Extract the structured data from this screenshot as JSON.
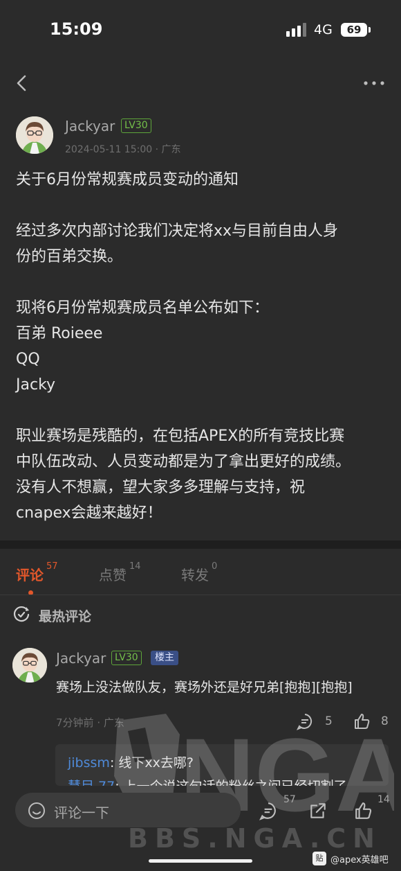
{
  "status_bar": {
    "time": "15:09",
    "network": "4G",
    "battery": "69"
  },
  "post": {
    "author": "Jackyar",
    "level": "LV30",
    "date": "2024-05-11  15:00",
    "location": "广东",
    "lines": [
      "关于6月份常规赛成员变动的通知",
      "",
      "经过多次内部讨论我们决定将xx与目前自由人身",
      "份的百弟交换。",
      "",
      "现将6月份常规赛成员名单公布如下：",
      "百弟 Roieee",
      "QQ",
      "Jacky",
      "",
      "职业赛场是残酷的，在包括APEX的所有竞技比赛",
      "中队伍改动、人员变动都是为了拿出更好的成绩。",
      "没有人不想赢，望大家多多理解与支持，祝",
      "cnapex会越来越好！"
    ]
  },
  "tabs": [
    {
      "label": "评论",
      "count": "57"
    },
    {
      "label": "点赞",
      "count": "14"
    },
    {
      "label": "转发",
      "count": "0"
    }
  ],
  "hot_comments": {
    "title": "最热评论"
  },
  "comment": {
    "author": "Jackyar",
    "level": "LV30",
    "owner_badge": "楼主",
    "text": "赛场上没法做队友，赛场外还是好兄弟[抱抱][抱抱]",
    "time": "7分钟前",
    "location": "广东",
    "reply_count": "5",
    "like_count": "8",
    "replies": [
      {
        "user": "jibssm",
        "text": "线下xx去哪?"
      },
      {
        "user": "慧目 77",
        "text": "上一个说这句话的粉丝之间已经切割了"
      }
    ]
  },
  "watermark": {
    "logo": "NGA",
    "site": "BBS.NGA.CN"
  },
  "bottom_bar": {
    "placeholder": "评论一下",
    "comment_count": "57",
    "like_count": "14"
  },
  "source_tag": {
    "logo": "贴",
    "text": "@apex英雄吧"
  },
  "colors": {
    "background": "#2b2b2b",
    "accent": "#e2572b",
    "level_green": "#74c04a",
    "owner_badge": "#3a4f86",
    "reply_user": "#4f8ad9"
  }
}
